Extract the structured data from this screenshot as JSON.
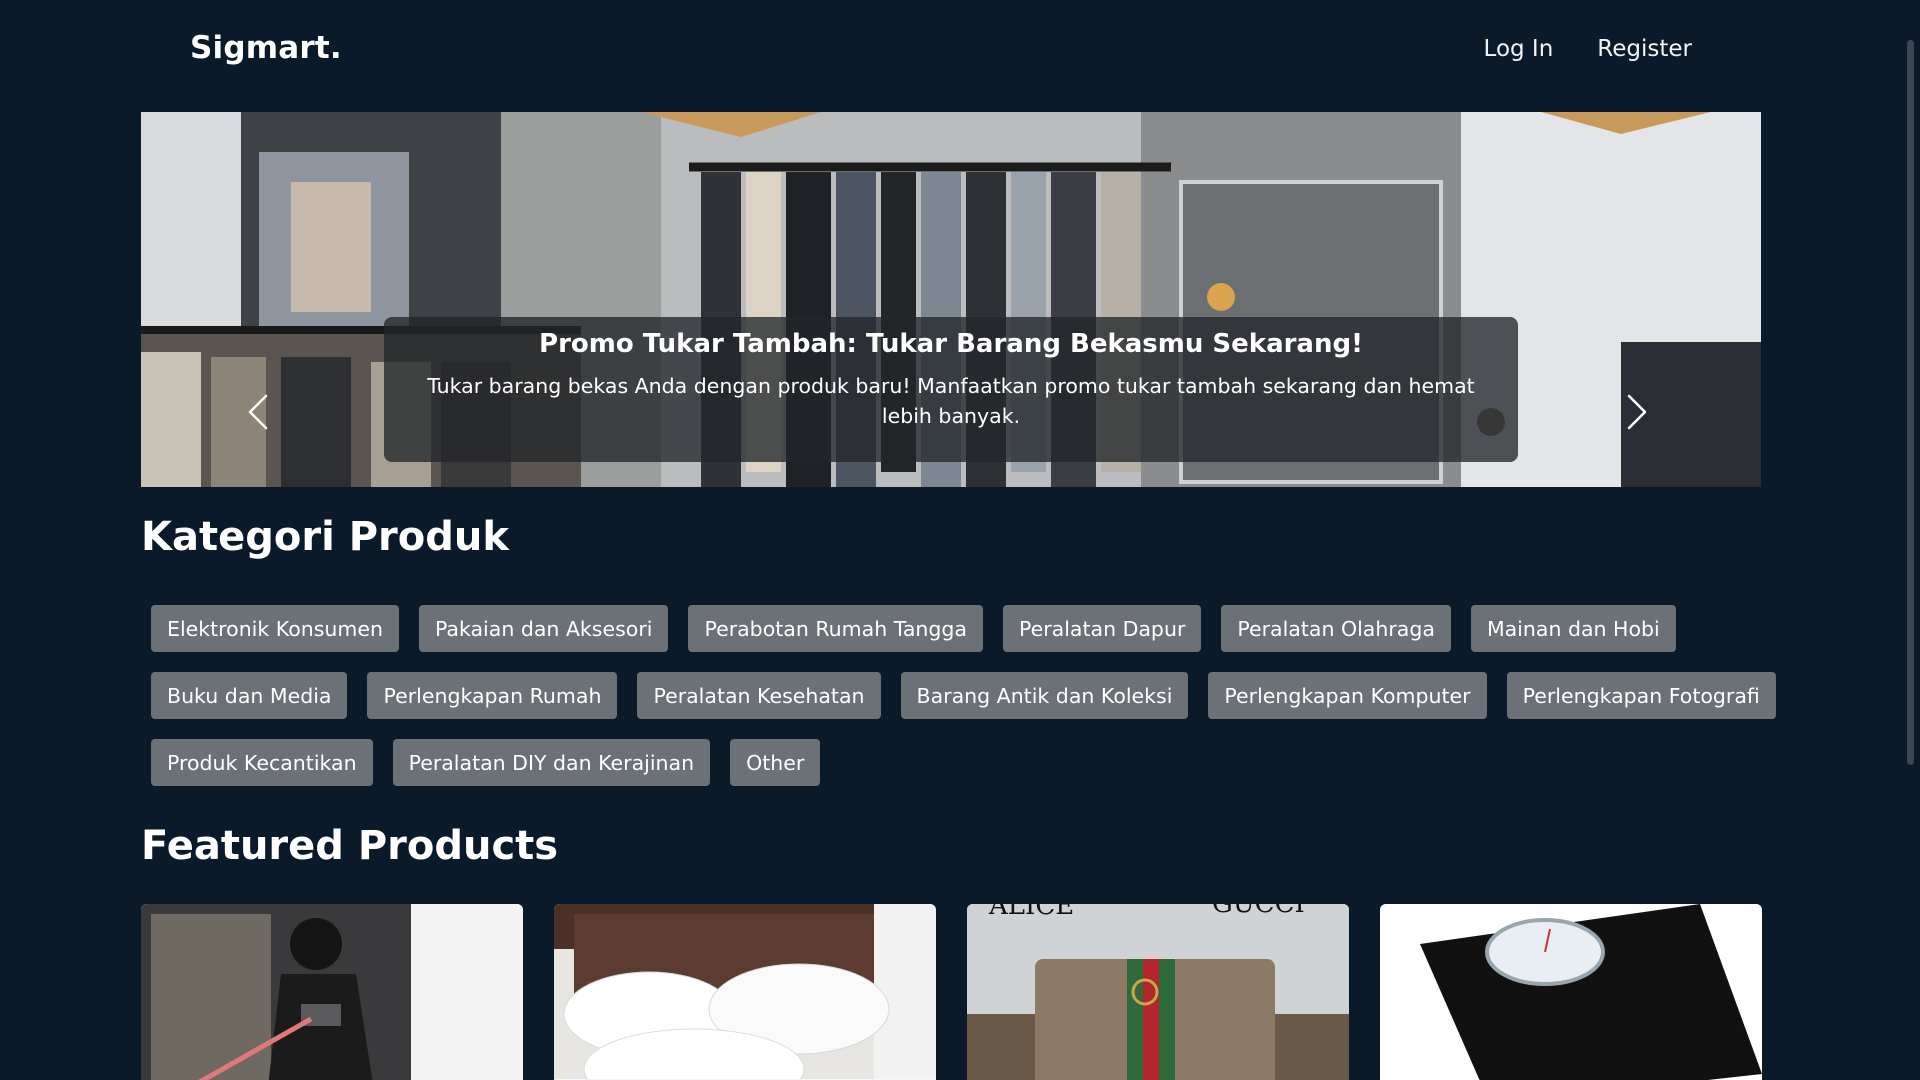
{
  "brand": {
    "name": "Sigmart."
  },
  "nav": {
    "login": "Log In",
    "register": "Register"
  },
  "hero": {
    "title": "Promo Tukar Tambah: Tukar Barang Bekasmu Sekarang!",
    "text": "Tukar barang bekas Anda dengan produk baru! Manfaatkan promo tukar tambah sekarang dan hemat lebih banyak.",
    "prev_icon": "chevron-left-icon",
    "next_icon": "chevron-right-icon"
  },
  "categories": {
    "title": "Kategori Produk",
    "rows": [
      [
        "Elektronik Konsumen",
        "Pakaian dan Aksesori",
        "Perabotan Rumah Tangga",
        "Peralatan Dapur",
        "Peralatan Olahraga",
        "Mainan dan Hobi"
      ],
      [
        "Buku dan Media",
        "Perlengkapan Rumah",
        "Peralatan Kesehatan",
        "Barang Antik dan Koleksi",
        "Perlengkapan Komputer",
        "Perlengkapan Fotografi"
      ],
      [
        "Produk Kecantikan",
        "Peralatan DIY dan Kerajinan",
        "Other"
      ]
    ]
  },
  "featured": {
    "title": "Featured Products",
    "products": [
      {
        "image": "action-figure-photo"
      },
      {
        "image": "pillows-bed-photo"
      },
      {
        "image": "handbag-photo",
        "image_text": [
          "ALICE",
          "GUCCI"
        ]
      },
      {
        "image": "weighing-scale-photo"
      }
    ]
  },
  "colors": {
    "background": "#0b1a2a",
    "chip": "#6b7177",
    "caption_bg": "rgba(35,38,42,0.78)"
  }
}
